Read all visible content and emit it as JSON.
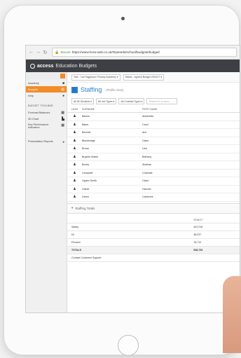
{
  "browser": {
    "secure_label": "Secure",
    "url": "https://www.hcss-web.co.uk/#/pseeds/school/budgets/budget/"
  },
  "app": {
    "brand": "access",
    "title": "Education Budgets"
  },
  "context": {
    "school_select": "Test - Carl Higginson Primary Academy",
    "budget_select": "Status - Agreed Budget 2016/17"
  },
  "sidebar": {
    "items": [
      {
        "label": "Academy"
      },
      {
        "label": "Budgets"
      },
      {
        "label": "Help"
      }
    ],
    "section_title": "BUDGET TOOLBAR",
    "tools": [
      {
        "label": "Forecast Balances"
      },
      {
        "label": "3D Chart"
      },
      {
        "label": "Key Performance Indicators"
      },
      {
        "label": "Presentation Reports"
      }
    ]
  },
  "staffing": {
    "title": "Staffing",
    "subtitle": "(Profile View)",
    "filters": [
      "All 60 Sections",
      "All Job Types",
      "All Contract Types"
    ],
    "search_placeholder": "Search for a name...",
    "columns": {
      "lead": "LEAD",
      "surname": "SURNAME",
      "first_name": "FIRST NAME"
    },
    "rows": [
      {
        "surname": "Barlow",
        "first_name": "Antoinette"
      },
      {
        "surname": "Baker",
        "first_name": "Carol"
      },
      {
        "surname": "Bennett",
        "first_name": "Ann"
      },
      {
        "surname": "Blackbridge",
        "first_name": "Claire"
      },
      {
        "surname": "Brown",
        "first_name": "Lisa"
      },
      {
        "surname": "Bryants Walsh",
        "first_name": "Bethany"
      },
      {
        "surname": "Burley",
        "first_name": "Siobhan"
      },
      {
        "surname": "Campbell",
        "first_name": "Charlotte"
      },
      {
        "surname": "Ogden Smith",
        "first_name": "Claire"
      },
      {
        "surname": "Clarke",
        "first_name": "Hannah"
      },
      {
        "surname": "Green",
        "first_name": "Catherine"
      }
    ]
  },
  "totals": {
    "title": "Staffing Totals",
    "column_header": "2016/17",
    "rows": [
      {
        "label": "Salary",
        "value": "422,016"
      },
      {
        "label": "NI",
        "value": "38,037"
      },
      {
        "label": "Pension",
        "value": "78,712"
      }
    ],
    "total": {
      "label": "TOTALS",
      "value": "538,733"
    },
    "footer": "Contact Customer Support"
  }
}
